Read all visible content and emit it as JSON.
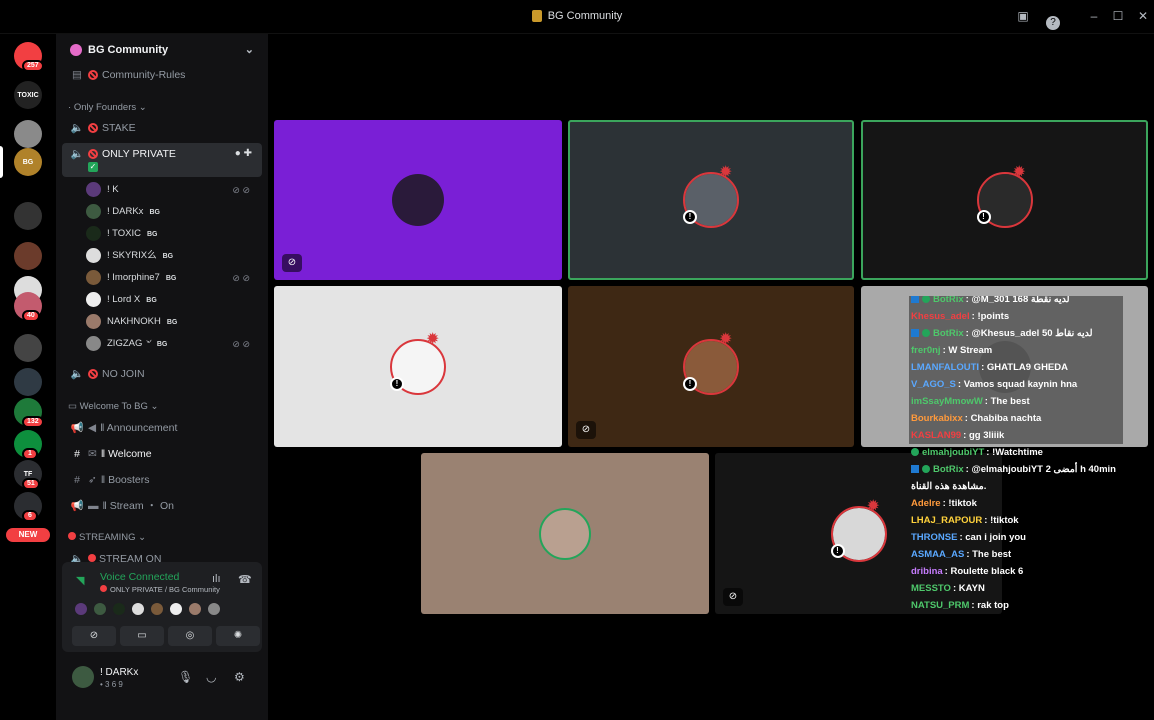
{
  "window": {
    "title": "BG Community"
  },
  "servers": [
    {
      "label": "",
      "badge": "257",
      "color": "#f23f42"
    },
    {
      "label": "TOXIC",
      "badge": "",
      "color": "#222"
    },
    {
      "label": "",
      "badge": "",
      "color": "#8a8a8a"
    },
    {
      "label": "BG",
      "badge": "",
      "color": "#b0822a"
    },
    {
      "label": "",
      "badge": "",
      "color": "#333"
    },
    {
      "label": "",
      "badge": "",
      "color": "#6b3b2b"
    },
    {
      "label": "",
      "badge": "",
      "color": "#ddd"
    },
    {
      "label": "",
      "badge": "40",
      "color": "#c35b6e"
    },
    {
      "label": "",
      "badge": "",
      "color": "#444"
    },
    {
      "label": "",
      "badge": "",
      "color": "#2f3a44"
    },
    {
      "label": "",
      "badge": "132",
      "color": "#1e7a3a"
    },
    {
      "label": "",
      "badge": "1",
      "color": "#0d8f3d"
    },
    {
      "label": "TF",
      "badge": "51",
      "color": "#2b2d31"
    },
    {
      "label": "",
      "badge": "6",
      "color": "#2b2d31"
    }
  ],
  "new_badge": "NEW",
  "sidebar": {
    "server_name": "BG Community",
    "channels_top": [
      {
        "name": "Community-Rules",
        "icon": "list-icon"
      }
    ],
    "cat_founders": "Only Founders",
    "ch_stake": "STAKE",
    "ch_private": "ONLY PRIVATE",
    "voice_users": [
      {
        "name": "! K",
        "tag": "",
        "muted": true,
        "av": "#5b3a7a"
      },
      {
        "name": "! DARKx",
        "tag": "BG",
        "muted": false,
        "av": "#3d5a41"
      },
      {
        "name": "! TOXIC",
        "tag": "BG",
        "muted": false,
        "av": "#1a2a1a"
      },
      {
        "name": "! SKYRIX么",
        "tag": "BG",
        "muted": false,
        "av": "#ddd"
      },
      {
        "name": "! Imorphine7",
        "tag": "BG",
        "muted": true,
        "av": "#7a5a3a"
      },
      {
        "name": "! Lord X",
        "tag": "BG",
        "muted": false,
        "av": "#eee"
      },
      {
        "name": "NAKHNOKH",
        "tag": "BG",
        "muted": false,
        "av": "#9a7a6a"
      },
      {
        "name": "ZIGZAG ৺",
        "tag": "BG",
        "muted": true,
        "av": "#888"
      }
    ],
    "ch_nojoin": "NO JOIN",
    "cat_welcome": "Welcome To BG",
    "ch_announcement": "Announcement",
    "ch_welcome": "Welcome",
    "ch_boosters": "Boosters",
    "ch_stream": "Stream ・ On",
    "cat_streaming": "STREAMING",
    "ch_streamon": "STREAM ON"
  },
  "voice": {
    "status": "Voice Connected",
    "channel": "ONLY PRIVATE / BG Community",
    "buttons": [
      "camera-off-icon",
      "share-screen-icon",
      "activity-icon",
      "soundboard-icon"
    ]
  },
  "user": {
    "name": "! DARKx",
    "status": "• 3 6 9"
  },
  "chat": [
    {
      "name": "BotRix",
      "color": "#4ec86b",
      "msg": "@M_301 168 لديه نقطة",
      "bot": true
    },
    {
      "name": "Khesus_adel",
      "color": "#f23f42",
      "msg": "!points",
      "bot": false
    },
    {
      "name": "BotRix",
      "color": "#4ec86b",
      "msg": "@Khesus_adel 50 لديه نقاط",
      "bot": true
    },
    {
      "name": "frer0nj",
      "color": "#4ec86b",
      "msg": "W Stream",
      "bot": false
    },
    {
      "name": "LMANFALOUTI",
      "color": "#5aa8ff",
      "msg": "GHATLA9 GHEDA",
      "bot": false
    },
    {
      "name": "V_AGO_S",
      "color": "#5aa8ff",
      "msg": "Vamos squad kaynin hna",
      "bot": false
    },
    {
      "name": "imSsayMmowW",
      "color": "#4ec86b",
      "msg": "The best",
      "bot": false
    },
    {
      "name": "Bourkabixx",
      "color": "#ff9a3c",
      "msg": "Chabiba nachta",
      "bot": false
    },
    {
      "name": "KASLAN99",
      "color": "#f23f42",
      "msg": "gg 3liiik",
      "bot": false
    },
    {
      "name": "elmahjoubiYT",
      "color": "#4ec86b",
      "msg": "!Watchtime",
      "bot": false
    },
    {
      "name": "BotRix",
      "color": "#4ec86b",
      "msg": "@elmahjoubiYT 2 أمضى h 40min",
      "bot": true
    },
    {
      "name": "",
      "color": "#fff",
      "msg": "مشاهدة هذه القناة.",
      "bot": false
    },
    {
      "name": "Adelre",
      "color": "#ff9a3c",
      "msg": "!tiktok",
      "bot": false
    },
    {
      "name": "LHAJ_RAPOUR",
      "color": "#ffd23c",
      "msg": "!tiktok",
      "bot": false
    },
    {
      "name": "THRONSE",
      "color": "#5aa8ff",
      "msg": "can i join you",
      "bot": false
    },
    {
      "name": "ASMAA_AS",
      "color": "#5aa8ff",
      "msg": "The best",
      "bot": false
    },
    {
      "name": "dribina",
      "color": "#c77dff",
      "msg": "Roulette black 6",
      "bot": false
    },
    {
      "name": "MESSTO",
      "color": "#4ec86b",
      "msg": "KAYN",
      "bot": false
    },
    {
      "name": "NATSU_PRM",
      "color": "#4ec86b",
      "msg": "rak top",
      "bot": false
    }
  ]
}
